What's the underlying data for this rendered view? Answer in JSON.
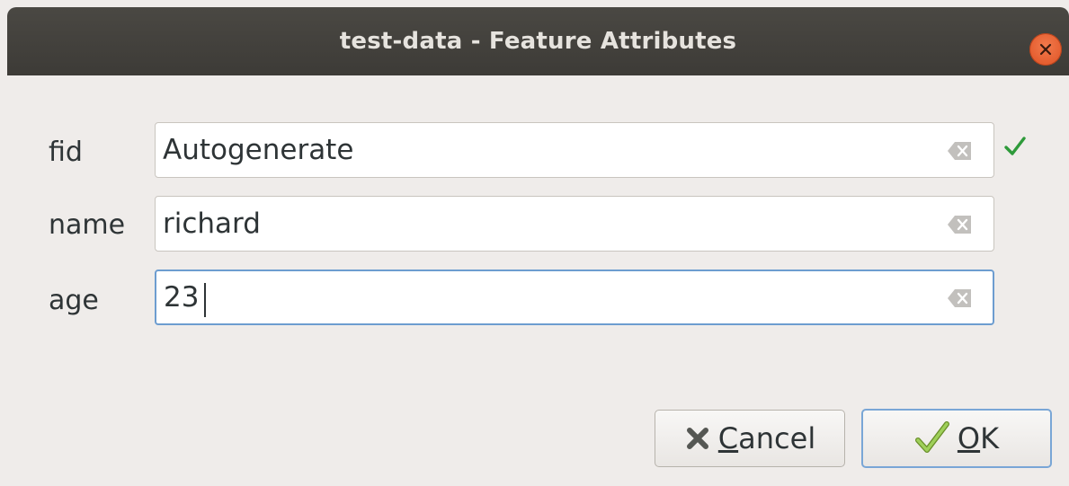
{
  "window": {
    "title": "test-data - Feature Attributes",
    "close_icon": "close-icon"
  },
  "fields": [
    {
      "label": "fid",
      "value": "Autogenerate",
      "clear_icon": "clear-text-icon",
      "valid": true,
      "valid_icon": "checkmark-icon"
    },
    {
      "label": "name",
      "value": "richard",
      "clear_icon": "clear-text-icon"
    },
    {
      "label": "age",
      "value": "23",
      "clear_icon": "clear-text-icon",
      "focused": true
    }
  ],
  "buttons": {
    "cancel": {
      "mnemonic": "C",
      "rest": "ancel",
      "icon": "cross-icon"
    },
    "ok": {
      "mnemonic": "O",
      "rest": "K",
      "icon": "checkmark-icon"
    }
  },
  "colors": {
    "titlebar": "#3d3b37",
    "close": "#df5123",
    "focus": "#6d9dd0",
    "valid_check": "#2e9a3a",
    "ok_check": "#7ac043"
  }
}
